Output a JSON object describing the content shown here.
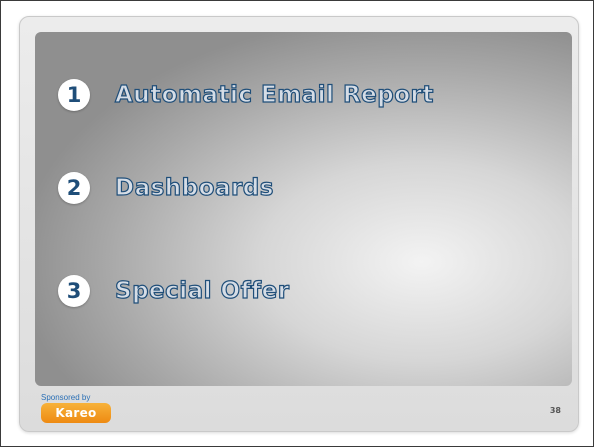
{
  "slide": {
    "items": [
      {
        "number": "1",
        "label": "Automatic Email Report"
      },
      {
        "number": "2",
        "label": "Dashboards"
      },
      {
        "number": "3",
        "label": "Special Offer"
      }
    ],
    "footer": {
      "sponsored_text": "Sponsored by",
      "logo_text": "Kareo",
      "page_number": "38"
    }
  },
  "colors": {
    "number_color": "#1f4e79",
    "logo_orange": "#ee8a12",
    "sponsored_blue": "#2a6fb5"
  }
}
